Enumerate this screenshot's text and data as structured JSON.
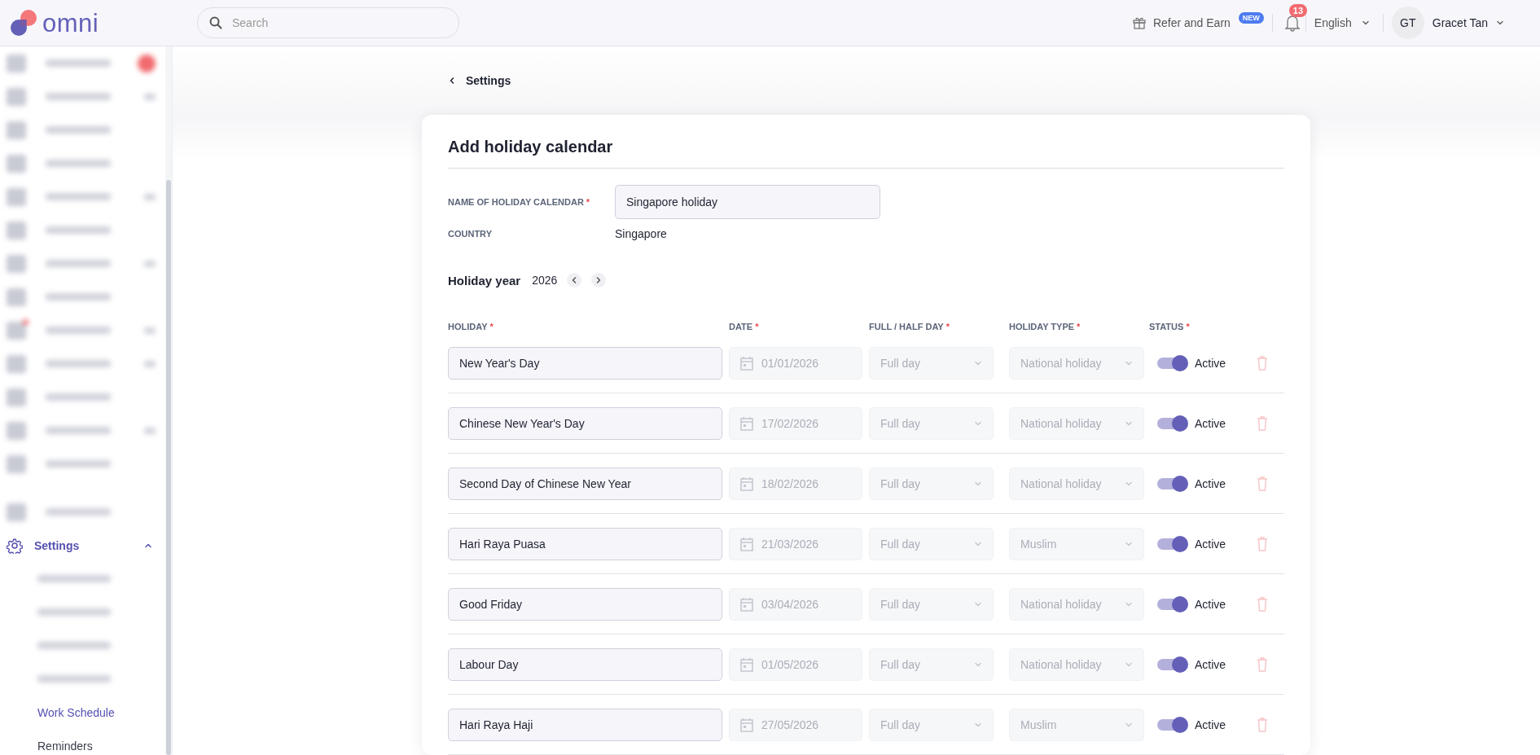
{
  "header": {
    "logo": "omni",
    "search": {
      "placeholder": "Search"
    },
    "refer": {
      "label": "Refer and Earn",
      "badge": "NEW"
    },
    "notifications": {
      "count": "13"
    },
    "language": "English",
    "user": {
      "initials": "GT",
      "name": "Gracet Tan"
    }
  },
  "sidebar": {
    "blurred_items": [
      {
        "kind": "badge"
      },
      {
        "kind": "expandable"
      },
      {
        "kind": "plain"
      },
      {
        "kind": "plain"
      },
      {
        "kind": "expandable"
      },
      {
        "kind": "plain"
      },
      {
        "kind": "expandable"
      },
      {
        "kind": "plain"
      },
      {
        "kind": "alert"
      },
      {
        "kind": "expandable"
      },
      {
        "kind": "plain"
      },
      {
        "kind": "expandable"
      },
      {
        "kind": "plain"
      },
      {
        "kind": "plain"
      }
    ],
    "section": {
      "label": "Settings",
      "expanded": true,
      "children": [
        {
          "kind": "blurred"
        },
        {
          "kind": "blurred"
        },
        {
          "kind": "blurred"
        },
        {
          "kind": "blurred"
        },
        {
          "kind": "link",
          "label": "Work Schedule",
          "selected": true
        },
        {
          "kind": "link",
          "label": "Reminders",
          "selected": false
        }
      ]
    }
  },
  "breadcrumb": {
    "back_label": "Settings"
  },
  "form": {
    "title": "Add holiday calendar",
    "name_field": {
      "label": "NAME OF HOLIDAY CALENDAR",
      "required_mark": "*",
      "value": "Singapore holiday"
    },
    "country": {
      "label": "COUNTRY",
      "value": "Singapore"
    },
    "year": {
      "label": "Holiday year",
      "value": "2026"
    },
    "columns": [
      {
        "label": "HOLIDAY",
        "required_mark": "*"
      },
      {
        "label": "DATE",
        "required_mark": "*"
      },
      {
        "label": "FULL / HALF DAY",
        "required_mark": "*"
      },
      {
        "label": "HOLIDAY TYPE",
        "required_mark": "*"
      },
      {
        "label": "STATUS",
        "required_mark": "*"
      }
    ],
    "rows": [
      {
        "name": "New Year's Day",
        "date": "01/01/2026",
        "day": "Full day",
        "type": "National holiday",
        "active": true,
        "status": "Active",
        "disabled": true
      },
      {
        "name": "Chinese New Year's Day",
        "date": "17/02/2026",
        "day": "Full day",
        "type": "National holiday",
        "active": true,
        "status": "Active",
        "disabled": true
      },
      {
        "name": "Second Day of Chinese New Year",
        "date": "18/02/2026",
        "day": "Full day",
        "type": "National holiday",
        "active": true,
        "status": "Active",
        "disabled": true
      },
      {
        "name": "Hari Raya Puasa",
        "date": "21/03/2026",
        "day": "Full day",
        "type": "Muslim",
        "active": true,
        "status": "Active",
        "disabled": true
      },
      {
        "name": "Good Friday",
        "date": "03/04/2026",
        "day": "Full day",
        "type": "National holiday",
        "active": true,
        "status": "Active",
        "disabled": true
      },
      {
        "name": "Labour Day",
        "date": "01/05/2026",
        "day": "Full day",
        "type": "National holiday",
        "active": true,
        "status": "Active",
        "disabled": true
      },
      {
        "name": "Hari Raya Haji",
        "date": "27/05/2026",
        "day": "Full day",
        "type": "Muslim",
        "active": true,
        "status": "Active",
        "disabled": true
      }
    ]
  }
}
